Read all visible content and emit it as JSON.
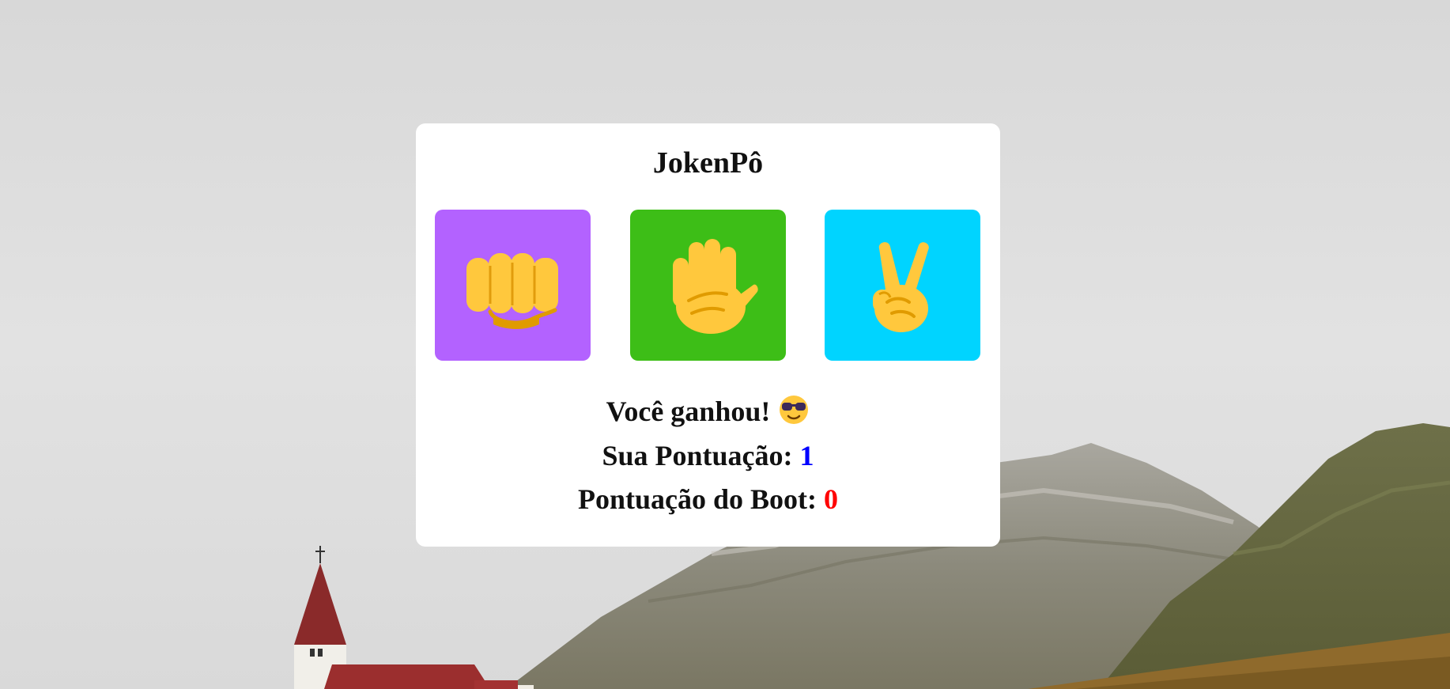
{
  "game": {
    "title": "JokenPô"
  },
  "choices": [
    {
      "id": "rock",
      "icon": "fist-icon",
      "color": "#b362ff"
    },
    {
      "id": "paper",
      "icon": "open-hand-icon",
      "color": "#3dbe17"
    },
    {
      "id": "scissors",
      "icon": "victory-hand-icon",
      "color": "#00d4ff"
    }
  ],
  "result": {
    "message": "Você ganhou!",
    "emoji_icon": "smiling-face-with-sunglasses-icon"
  },
  "score": {
    "player_label": "Sua Pontuação:",
    "player_value": "1",
    "player_color": "#0000ff",
    "bot_label": "Pontuação do Boot:",
    "bot_value": "0",
    "bot_color": "#ff0000"
  }
}
